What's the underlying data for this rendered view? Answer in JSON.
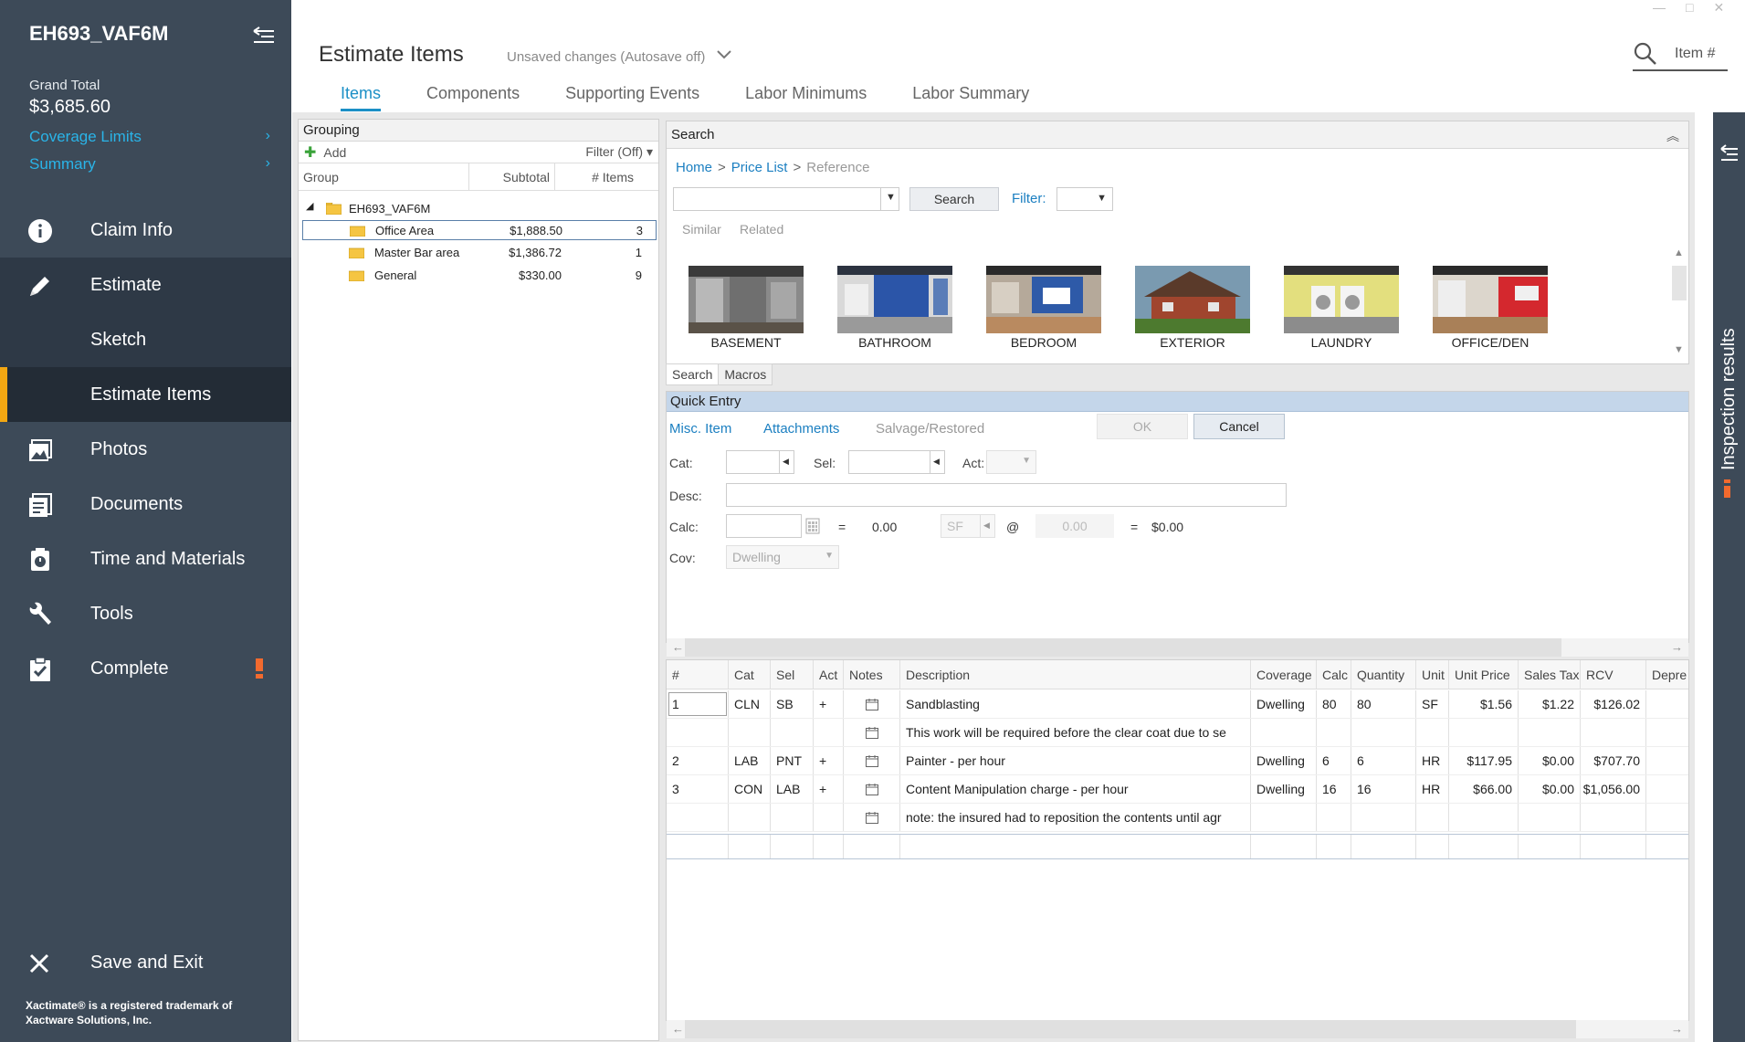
{
  "sidebar": {
    "title": "EH693_VAF6M",
    "grand_total_label": "Grand Total",
    "grand_total_value": "$3,685.60",
    "links": [
      {
        "label": "Coverage Limits"
      },
      {
        "label": "Summary"
      }
    ],
    "nav": [
      {
        "label": "Claim Info",
        "icon": "info-icon"
      },
      {
        "label": "Estimate",
        "icon": "pencil-icon"
      },
      {
        "label": "Sketch"
      },
      {
        "label": "Estimate Items"
      },
      {
        "label": "Photos",
        "icon": "photos-icon"
      },
      {
        "label": "Documents",
        "icon": "documents-icon"
      },
      {
        "label": "Time and Materials",
        "icon": "timer-icon"
      },
      {
        "label": "Tools",
        "icon": "wrench-icon"
      },
      {
        "label": "Complete",
        "icon": "clipboard-check-icon"
      }
    ],
    "save_exit": "Save and Exit",
    "footer": "Xactimate® is a registered trademark of Xactware Solutions, Inc.",
    "accent_color": "#f3a712",
    "link_color": "#2ab4e8"
  },
  "header": {
    "title": "Estimate Items",
    "status": "Unsaved changes (Autosave off)",
    "search_placeholder": "Item #",
    "tabs": [
      "Items",
      "Components",
      "Supporting Events",
      "Labor Minimums",
      "Labor Summary"
    ]
  },
  "inspection": {
    "label": "Inspection results"
  },
  "grouping": {
    "title": "Grouping",
    "add_label": "Add",
    "filter_label": "Filter (Off)",
    "columns": [
      "Group",
      "Subtotal",
      "# Items"
    ],
    "root": "EH693_VAF6M",
    "rows": [
      {
        "name": "Office Area",
        "subtotal": "$1,888.50",
        "count": "3"
      },
      {
        "name": "Master Bar area",
        "subtotal": "$1,386.72",
        "count": "1"
      },
      {
        "name": "General",
        "subtotal": "$330.00",
        "count": "9"
      }
    ]
  },
  "search": {
    "title": "Search",
    "breadcrumb": [
      "Home",
      "Price List",
      "Reference"
    ],
    "button": "Search",
    "filter_label": "Filter:",
    "subtabs": [
      "Similar",
      "Related"
    ],
    "rooms": [
      "BASEMENT",
      "BATHROOM",
      "BEDROOM",
      "EXTERIOR",
      "LAUNDRY",
      "OFFICE/DEN"
    ],
    "bottom_tabs": [
      "Search",
      "Macros"
    ]
  },
  "quick_entry": {
    "title": "Quick Entry",
    "tabs": [
      "Misc. Item",
      "Attachments",
      "Salvage/Restored"
    ],
    "ok": "OK",
    "cancel": "Cancel",
    "labels": {
      "cat": "Cat:",
      "sel": "Sel:",
      "act": "Act:",
      "desc": "Desc:",
      "calc": "Calc:",
      "cov": "Cov:"
    },
    "calc_result": "0.00",
    "unit": "SF",
    "unit_price": "0.00",
    "total": "$0.00",
    "coverage": "Dwelling",
    "equals": "=",
    "at": "@"
  },
  "items_table": {
    "columns": [
      "#",
      "Cat",
      "Sel",
      "Act",
      "Notes",
      "Description",
      "Coverage",
      "Calc",
      "Quantity",
      "Unit",
      "Unit Price",
      "Sales Tax",
      "RCV",
      "Depre"
    ],
    "rows": [
      {
        "num": "1",
        "cat": "CLN",
        "sel": "SB",
        "act": "+",
        "desc": "Sandblasting",
        "coverage": "Dwelling",
        "calc": "80",
        "qty": "80",
        "unit": "SF",
        "unit_price": "$1.56",
        "tax": "$1.22",
        "rcv": "$126.02"
      },
      {
        "num": "",
        "cat": "",
        "sel": "",
        "act": "",
        "desc": "This work will be required before the clear coat due to se",
        "coverage": "",
        "calc": "",
        "qty": "",
        "unit": "",
        "unit_price": "",
        "tax": "",
        "rcv": ""
      },
      {
        "num": "2",
        "cat": "LAB",
        "sel": "PNT",
        "act": "+",
        "desc": "Painter - per hour",
        "coverage": "Dwelling",
        "calc": "6",
        "qty": "6",
        "unit": "HR",
        "unit_price": "$117.95",
        "tax": "$0.00",
        "rcv": "$707.70"
      },
      {
        "num": "3",
        "cat": "CON",
        "sel": "LAB",
        "act": "+",
        "desc": "Content Manipulation charge - per hour",
        "coverage": "Dwelling",
        "calc": "16",
        "qty": "16",
        "unit": "HR",
        "unit_price": "$66.00",
        "tax": "$0.00",
        "rcv": "$1,056.00"
      },
      {
        "num": "",
        "cat": "",
        "sel": "",
        "act": "",
        "desc": "note: the insured had to reposition the contents until agr",
        "coverage": "",
        "calc": "",
        "qty": "",
        "unit": "",
        "unit_price": "",
        "tax": "",
        "rcv": ""
      }
    ]
  }
}
